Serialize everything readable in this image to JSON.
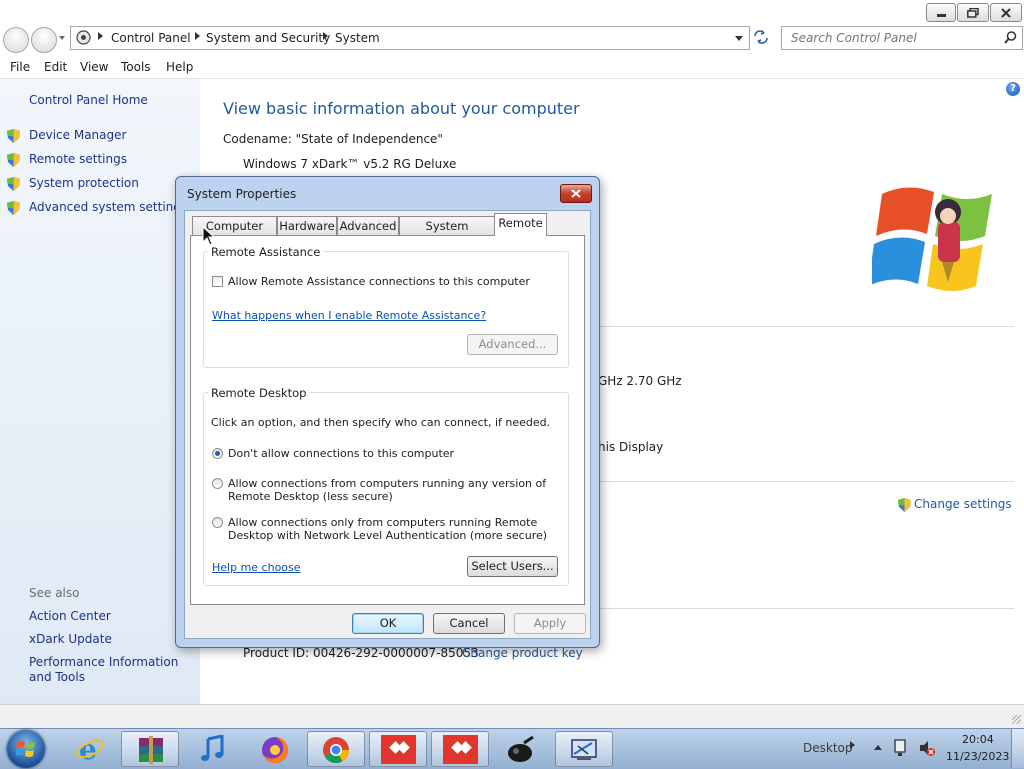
{
  "window": {
    "breadcrumb": [
      "Control Panel",
      "System and Security",
      "System"
    ],
    "search_placeholder": "Search Control Panel",
    "menu": [
      "File",
      "Edit",
      "View",
      "Tools",
      "Help"
    ]
  },
  "left_pane": {
    "home": "Control Panel Home",
    "links": [
      "Device Manager",
      "Remote settings",
      "System protection",
      "Advanced system settings"
    ],
    "see_also_heading": "See also",
    "see_also": [
      "Action Center",
      "xDark Update",
      "Performance Information and Tools"
    ]
  },
  "content": {
    "title": "View basic information about your computer",
    "codename": "Codename: \"State of Independence\"",
    "edition": "Windows 7 xDark™ v5.2 RG Deluxe",
    "processor_fragment": "GHz  2.70 GHz",
    "display_fragment": "his Display",
    "change_settings": "Change settings",
    "product_id": "Product ID: 00426-292-0000007-85053",
    "change_product_key": "Change product key"
  },
  "dialog": {
    "title": "System Properties",
    "tabs": [
      "Computer Name",
      "Hardware",
      "Advanced",
      "System Protection",
      "Remote"
    ],
    "active_tab": "Remote",
    "remote_assistance": {
      "heading": "Remote Assistance",
      "checkbox_label": "Allow Remote Assistance connections to this computer",
      "checked": false,
      "link": "What happens when I enable Remote Assistance?",
      "advanced_button": "Advanced..."
    },
    "remote_desktop": {
      "heading": "Remote Desktop",
      "instruction": "Click an option, and then specify who can connect, if needed.",
      "options": [
        {
          "line1": "Don't allow connections to this computer",
          "line2": ""
        },
        {
          "line1": "Allow connections from computers running any version of",
          "line2": "Remote Desktop (less secure)"
        },
        {
          "line1": "Allow connections only from computers running Remote",
          "line2": "Desktop with Network Level Authentication (more secure)"
        }
      ],
      "selected_option": 0,
      "help_link": "Help me choose",
      "select_users_button": "Select Users..."
    },
    "buttons": {
      "ok": "OK",
      "cancel": "Cancel",
      "apply": "Apply"
    }
  },
  "taskbar": {
    "desktop_label": "Desktop",
    "time": "20:04",
    "date": "11/23/2023",
    "apps": [
      "start-orb",
      "internet-explorer",
      "winrar",
      "music-player",
      "firefox",
      "chrome",
      "anydesk",
      "anydesk",
      "audio-app",
      "control-panel"
    ]
  },
  "colors": {
    "link_blue": "#1e3287",
    "title_blue": "#1e5aa0",
    "dialog_frame": "#bcd2ee",
    "close_red": "#c6402a"
  }
}
